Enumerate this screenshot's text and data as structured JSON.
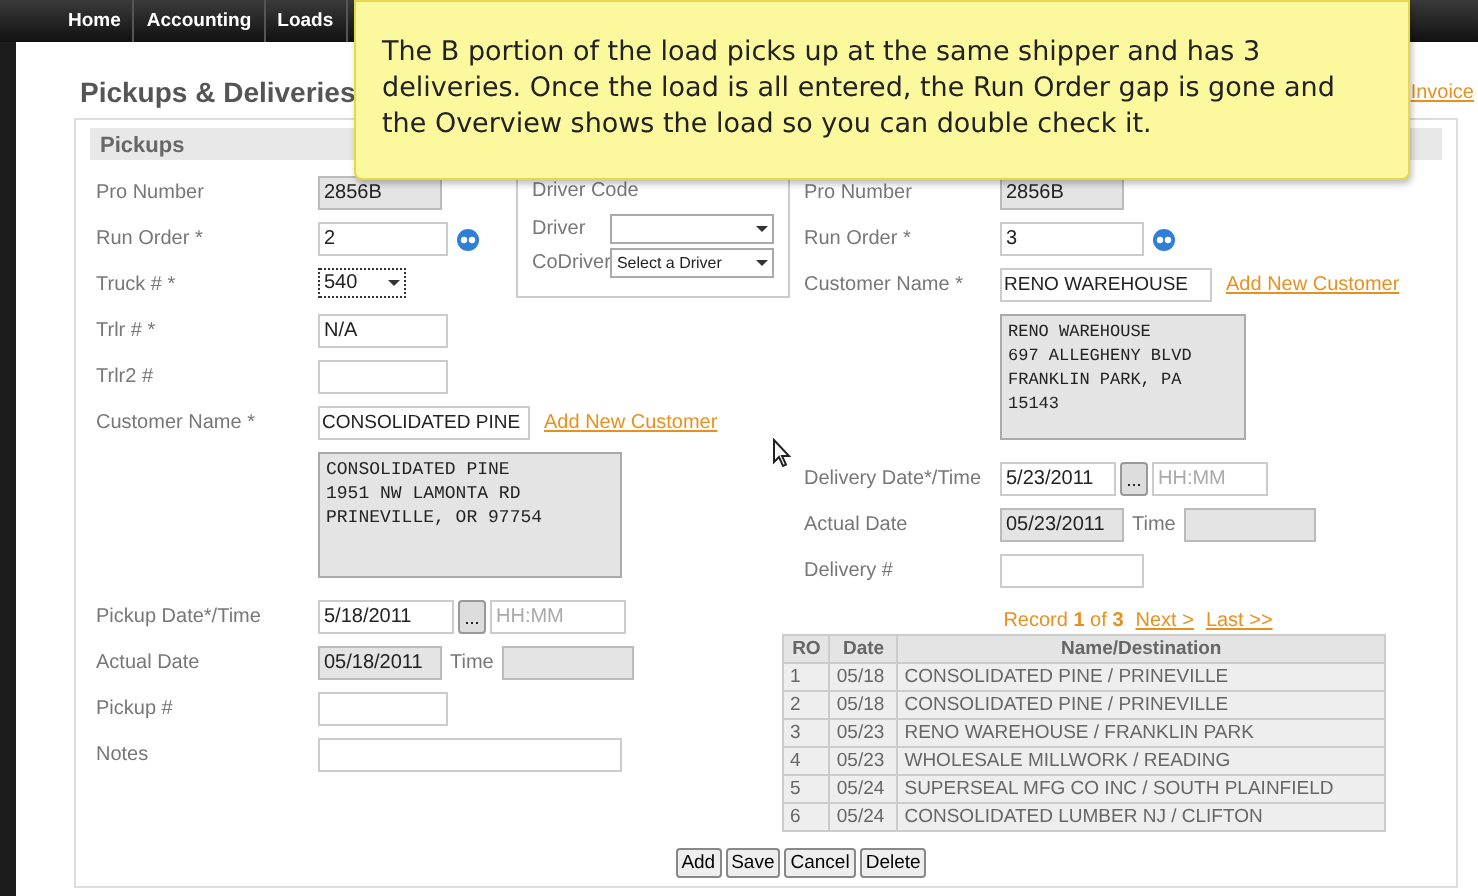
{
  "nav": [
    {
      "label": "Home"
    },
    {
      "label": "Accounting"
    },
    {
      "label": "Loads"
    }
  ],
  "page_title": "Pickups & Deliveries",
  "invoice_link": "Invoice",
  "callout": "The B portion of the load picks up at the same shipper and has 3 deliveries. Once the load is all entered, the Run Order gap is gone and the Overview shows the load so you can double check it.",
  "pickups": {
    "header": "Pickups",
    "fields": [
      {
        "kind": "readonly",
        "label": "Pro Number",
        "value": "2856B"
      },
      {
        "kind": "lookup",
        "label": "Run Order *",
        "value": "2"
      },
      {
        "kind": "select",
        "label": "Truck # *",
        "value": "540"
      },
      {
        "kind": "text",
        "label": "Trlr # *",
        "value": "N/A"
      },
      {
        "kind": "text",
        "label": "Trlr2 #"
      },
      {
        "kind": "customer",
        "label": "Customer Name *",
        "value": "CONSOLIDATED PINE",
        "link": "Add New Customer"
      },
      {
        "kind": "address",
        "value": "CONSOLIDATED PINE\n1951 NW LAMONTA RD\nPRINEVILLE, OR 97754"
      },
      {
        "kind": "datetime",
        "label": "Pickup Date*/Time",
        "value": "5/18/2011",
        "button": "...",
        "placeholder": "HH:MM"
      },
      {
        "kind": "actual",
        "label": "Actual Date",
        "value": "05/18/2011",
        "time_label": "Time"
      },
      {
        "kind": "text",
        "label": "Pickup #"
      },
      {
        "kind": "notes",
        "label": "Notes"
      }
    ]
  },
  "driver_box": {
    "legend": "Driver Code",
    "drivers": [
      {
        "label": "Driver"
      },
      {
        "label": "CoDriver",
        "value": "Select a Driver"
      }
    ]
  },
  "deliveries": {
    "fields": [
      {
        "kind": "readonly",
        "label": "Pro Number",
        "value": "2856B"
      },
      {
        "kind": "lookup",
        "label": "Run Order *",
        "value": "3"
      },
      {
        "kind": "customer",
        "label": "Customer Name *",
        "value": "RENO WAREHOUSE",
        "link": "Add New Customer"
      },
      {
        "kind": "address",
        "value": "RENO WAREHOUSE\n697 ALLEGHENY BLVD\nFRANKLIN PARK, PA 15143"
      },
      {
        "kind": "datetime",
        "label": "Delivery Date*/Time",
        "value": "5/23/2011",
        "button": "...",
        "placeholder": "HH:MM"
      },
      {
        "kind": "actual",
        "label": "Actual Date",
        "value": "05/23/2011",
        "time_label": "Time"
      },
      {
        "kind": "text",
        "label": "Delivery #"
      }
    ],
    "record": "Record **1** of **3**",
    "next": "Next >",
    "last": "Last >>"
  },
  "table": {
    "columns": [
      "RO",
      "Date",
      "Name/Destination"
    ],
    "rows": [
      [
        "1",
        "05/18",
        "CONSOLIDATED PINE / PRINEVILLE"
      ],
      [
        "2",
        "05/18",
        "CONSOLIDATED PINE / PRINEVILLE"
      ],
      [
        "3",
        "05/23",
        "RENO WAREHOUSE / FRANKLIN PARK"
      ],
      [
        "4",
        "05/23",
        "WHOLESALE MILLWORK / READING"
      ],
      [
        "5",
        "05/24",
        "SUPERSEAL MFG CO INC / SOUTH PLAINFIELD"
      ],
      [
        "6",
        "05/24",
        "CONSOLIDATED LUMBER NJ / CLIFTON"
      ]
    ]
  },
  "buttons": [
    "Add",
    "Save",
    "Cancel",
    "Delete"
  ]
}
